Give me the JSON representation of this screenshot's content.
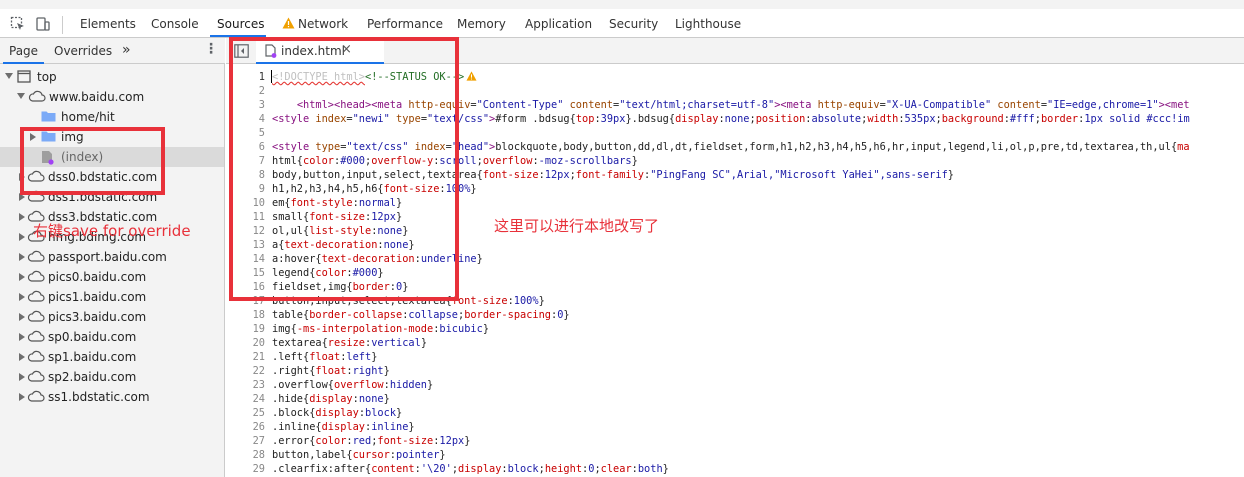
{
  "toolbar": {
    "tabs": [
      {
        "label": "Elements"
      },
      {
        "label": "Console"
      },
      {
        "label": "Sources"
      },
      {
        "label": "Network"
      },
      {
        "label": "Performance"
      },
      {
        "label": "Memory"
      },
      {
        "label": "Application"
      },
      {
        "label": "Security"
      },
      {
        "label": "Lighthouse"
      }
    ],
    "active_tab": "Sources",
    "network_warning_icon": "warning-triangle-icon"
  },
  "navigator": {
    "tabs": [
      {
        "label": "Page"
      },
      {
        "label": "Overrides"
      }
    ],
    "more_icon": "double-chevron-icon",
    "menu_icon": "kebab-menu-icon",
    "tree": [
      {
        "label": "top",
        "icon": "frame-icon",
        "expanded": true
      },
      {
        "label": "www.baidu.com",
        "icon": "cloud-icon",
        "expanded": true
      },
      {
        "label": "home/hit",
        "icon": "folder-icon"
      },
      {
        "label": "img",
        "icon": "folder-icon"
      },
      {
        "label": "(index)",
        "icon": "file-icon",
        "selected": true
      },
      {
        "label": "dss0.bdstatic.com",
        "icon": "cloud-icon"
      },
      {
        "label": "dss1.bdstatic.com",
        "icon": "cloud-icon"
      },
      {
        "label": "dss3.bdstatic.com",
        "icon": "cloud-icon"
      },
      {
        "label": "hmg.bdimg.com",
        "icon": "cloud-icon"
      },
      {
        "label": "passport.baidu.com",
        "icon": "cloud-icon"
      },
      {
        "label": "pics0.baidu.com",
        "icon": "cloud-icon"
      },
      {
        "label": "pics1.baidu.com",
        "icon": "cloud-icon"
      },
      {
        "label": "pics3.baidu.com",
        "icon": "cloud-icon"
      },
      {
        "label": "sp0.baidu.com",
        "icon": "cloud-icon"
      },
      {
        "label": "sp1.baidu.com",
        "icon": "cloud-icon"
      },
      {
        "label": "sp2.baidu.com",
        "icon": "cloud-icon"
      },
      {
        "label": "ss1.bdstatic.com",
        "icon": "cloud-icon"
      }
    ]
  },
  "editor": {
    "file_tab": {
      "label": "index.html",
      "close": "×"
    },
    "toggle_navigator_icon": "toggle-navigator-icon",
    "lines": [
      "1",
      "2",
      "3",
      "4",
      "5",
      "6",
      "7",
      "8",
      "9",
      "10",
      "11",
      "12",
      "13",
      "14",
      "15",
      "16",
      "17",
      "18",
      "19",
      "20",
      "21",
      "22",
      "23",
      "24",
      "25",
      "26",
      "27",
      "28",
      "29"
    ]
  },
  "annotations": {
    "right_click_note": "右键save for override",
    "edit_note": "这里可以进行本地改写了"
  },
  "colors": {
    "accent": "#1a73e8",
    "annotation_red": "#e8313a",
    "warning": "#f0a000"
  }
}
